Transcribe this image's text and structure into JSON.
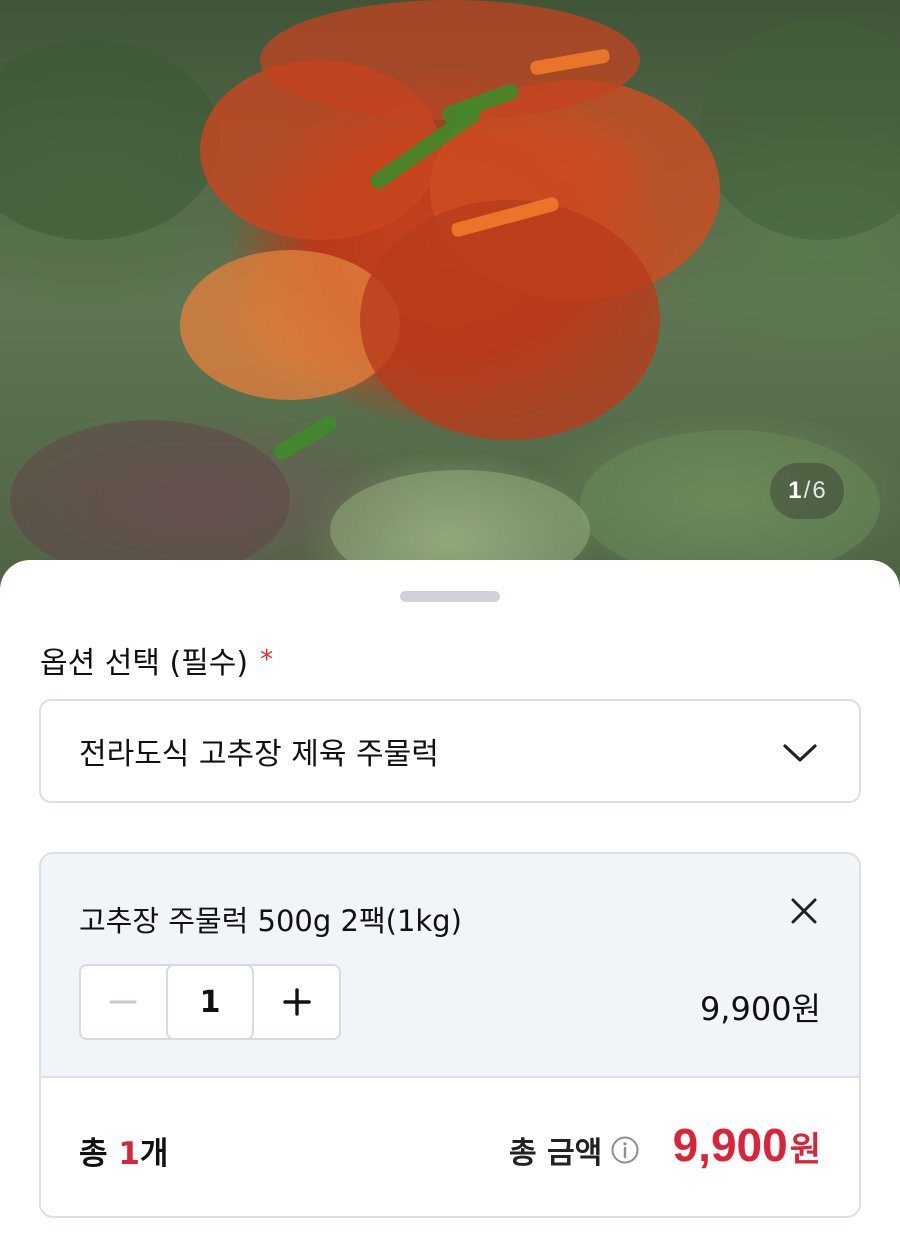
{
  "gallery": {
    "current": "1",
    "separator": "/",
    "total": "6"
  },
  "option_section": {
    "title": "옵션 선택 (필수)",
    "required_mark": "*",
    "selected_option": "전라도식 고추장 제육 주물럭",
    "dropdown_icon": "chevron-down-icon"
  },
  "selected_item": {
    "name": "고추장 주물럭 500g 2팩(1kg)",
    "remove_icon": "close-icon",
    "quantity": "1",
    "decrement_icon": "minus-icon",
    "increment_icon": "plus-icon",
    "price": "9,900원"
  },
  "summary": {
    "count_prefix": "총 ",
    "count_value": "1",
    "count_suffix": "개",
    "total_label": "총 금액",
    "info_icon": "info-icon",
    "total_amount": "9,900",
    "total_currency": "원"
  },
  "colors": {
    "accent_red": "#d8253a",
    "required_star": "#e22a35",
    "card_bg": "#f1f4f8",
    "border": "#dcdfe3"
  }
}
